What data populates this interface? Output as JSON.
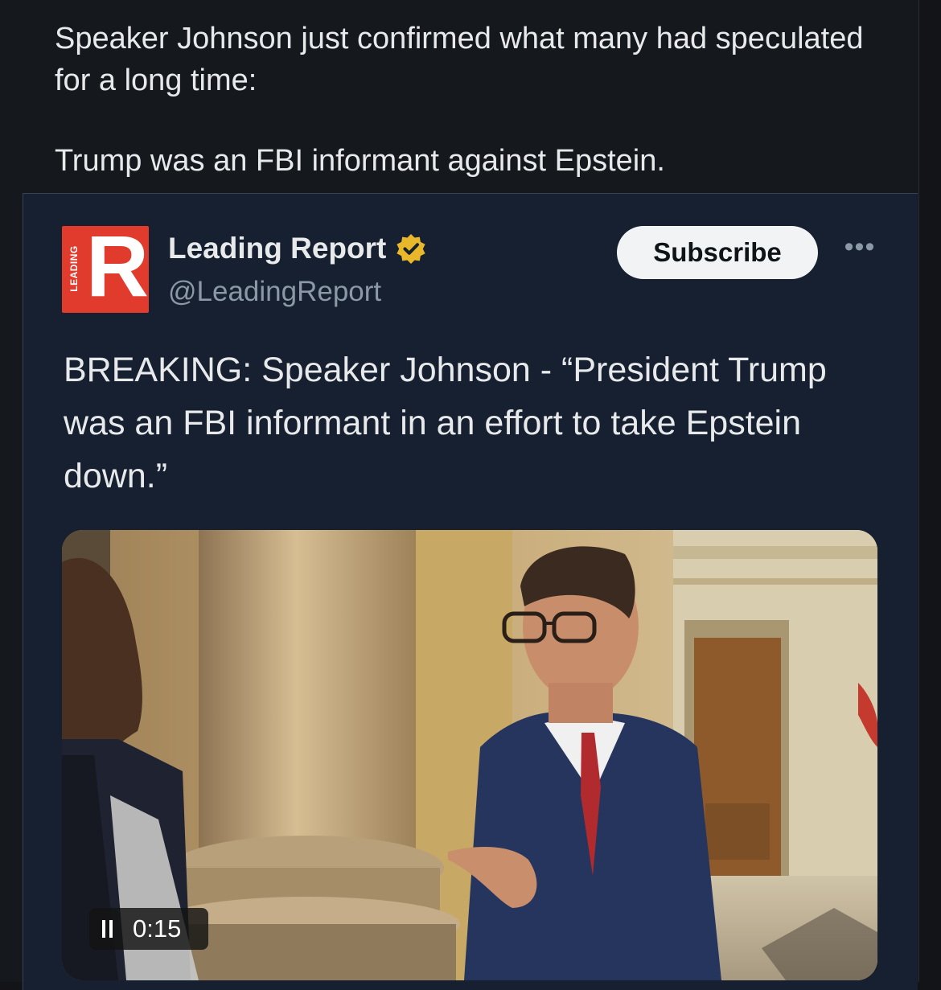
{
  "post": {
    "line1": "Speaker Johnson just confirmed what many had speculated for a long time:",
    "line2": "Trump was an FBI informant against Epstein."
  },
  "quoted_tweet": {
    "avatar": {
      "letter": "R",
      "side_text": "LEADING"
    },
    "author_name": "Leading Report",
    "verified": true,
    "handle": "@LeadingReport",
    "subscribe_label": "Subscribe",
    "more_label": "•••",
    "text": "BREAKING: Speaker Johnson - “President Trump was an FBI informant in an effort to take Epstein down.”",
    "video": {
      "state": "playing",
      "timestamp": "0:15"
    }
  },
  "icons": {
    "verified": "verified-badge-icon",
    "more": "more-options-icon",
    "pause": "pause-icon"
  },
  "colors": {
    "background": "#15181d",
    "card": "#162030",
    "brand_red": "#e03b2d",
    "verified_gold": "#e8b82a",
    "muted_text": "#8b98a5"
  }
}
